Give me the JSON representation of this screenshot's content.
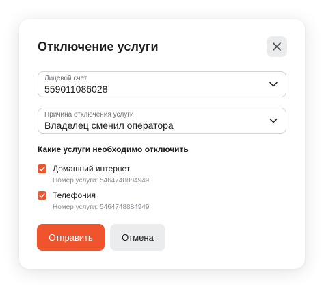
{
  "colors": {
    "accent": "#f0542c",
    "secondary_button_bg": "#ebecee",
    "text": "#1c1c1e",
    "muted_text": "#8a8e94"
  },
  "dialog": {
    "title": "Отключение услуги",
    "close_icon": "close-icon"
  },
  "account_select": {
    "label": "Лицевой счет",
    "value": "559011086028",
    "icon": "chevron-down-icon"
  },
  "reason_select": {
    "label": "Причина отключения услуги",
    "value": "Владелец сменил оператора",
    "icon": "chevron-down-icon"
  },
  "services_section": {
    "title": "Какие услуги необходимо отключить",
    "items": [
      {
        "name": "Домашний интернет",
        "number": "Номер услуги: 5464748884949",
        "checked": true
      },
      {
        "name": "Телефония",
        "number": "Номер услуги: 5464748884949",
        "checked": true
      }
    ]
  },
  "actions": {
    "submit_label": "Отправить",
    "cancel_label": "Отмена"
  }
}
